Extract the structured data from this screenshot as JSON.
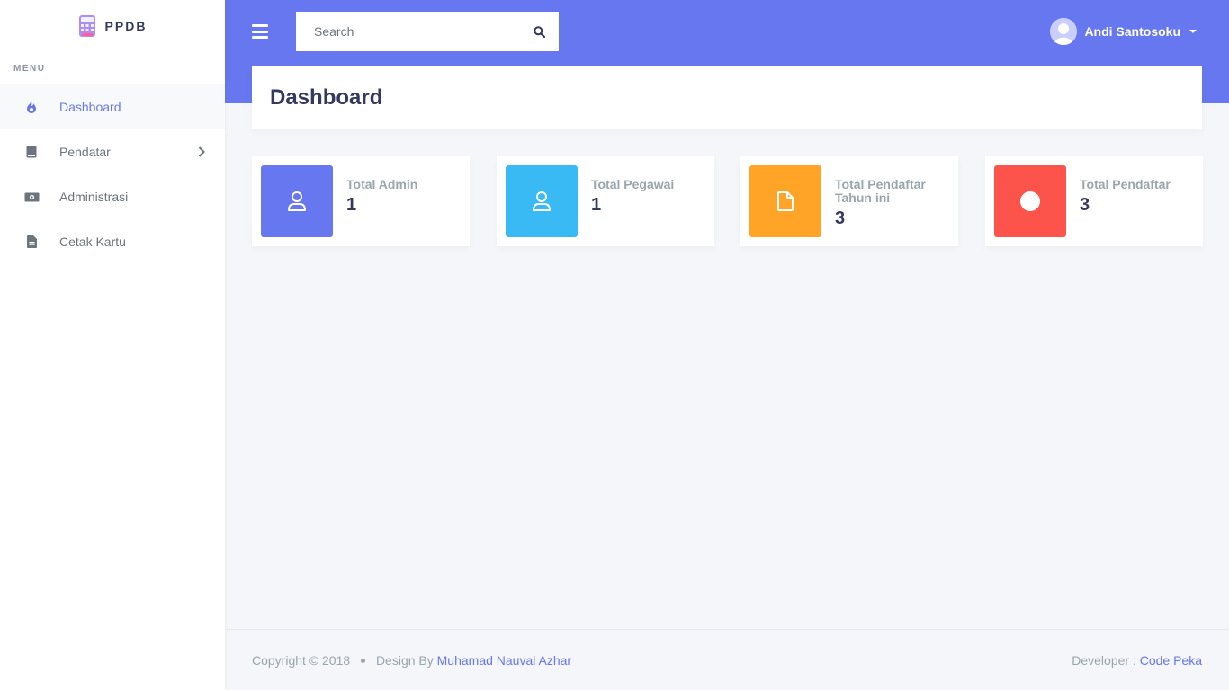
{
  "brand": {
    "name": "PPDB"
  },
  "sidebar": {
    "menu_header": "MENU",
    "items": [
      {
        "label": "Dashboard",
        "icon": "fire-icon",
        "active": true
      },
      {
        "label": "Pendatar",
        "icon": "book-icon",
        "has_submenu": true
      },
      {
        "label": "Administrasi",
        "icon": "money-bill-icon"
      },
      {
        "label": "Cetak Kartu",
        "icon": "file-icon"
      }
    ]
  },
  "topbar": {
    "search_placeholder": "Search",
    "user_name": "Andi Santosoku"
  },
  "page": {
    "title": "Dashboard"
  },
  "stats": [
    {
      "label": "Total Admin",
      "value": "1",
      "color": "#6777ef",
      "icon": "user-icon"
    },
    {
      "label": "Total Pegawai",
      "value": "1",
      "color": "#3abaf4",
      "icon": "user-icon"
    },
    {
      "label": "Total Pendaftar Tahun ini",
      "value": "3",
      "color": "#ffa426",
      "icon": "file-icon"
    },
    {
      "label": "Total Pendaftar",
      "value": "3",
      "color": "#fc544b",
      "icon": "circle-icon"
    }
  ],
  "footer": {
    "copyright": "Copyright © 2018",
    "design_by": "Design By",
    "designer": "Muhamad Nauval Azhar",
    "developer_label": "Developer :",
    "developer": "Code Peka"
  },
  "colors": {
    "primary": "#6777ef",
    "info": "#3abaf4",
    "warning": "#ffa426",
    "danger": "#fc544b",
    "background": "#f4f6f9"
  }
}
